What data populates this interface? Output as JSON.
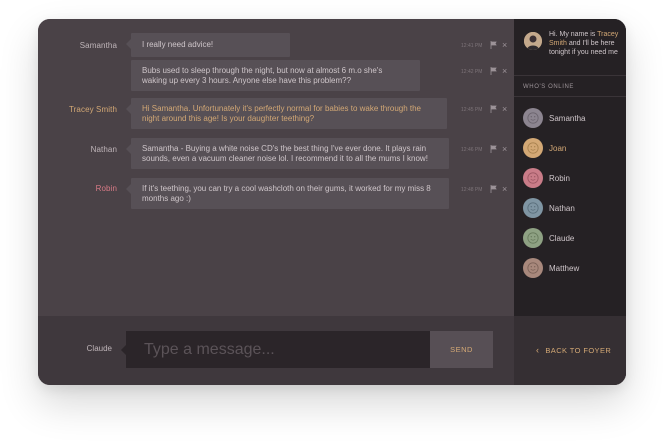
{
  "messages": [
    {
      "author": "Samantha",
      "text": "I really need advice!",
      "time": "12:41 PM"
    },
    {
      "author": "",
      "text": "Bubs used to sleep through the night, but now at almost 6 m.o she's waking up every 3 hours. Anyone else have this problem??",
      "time": "12:42 PM"
    },
    {
      "author": "Tracey Smith",
      "text": "Hi Samantha. Unfortunately it's perfectly normal for babies to wake through the night around this age! Is your daughter teething?",
      "time": "12:45 PM"
    },
    {
      "author": "Nathan",
      "text": "Samantha - Buying a white noise CD's the best thing I've ever done. It plays rain sounds, even a vacuum cleaner noise lol. I recommend it to all the mums I know!",
      "time": "12:46 PM"
    },
    {
      "author": "Robin",
      "text": "If it's teething, you can try a cool washcloth on their gums, it worked for my miss 8 months ago :)",
      "time": "12:48 PM"
    }
  ],
  "composer": {
    "user": "Claude",
    "placeholder": "Type a message...",
    "send_label": "SEND"
  },
  "sidebar": {
    "welcome_prefix": "Hi. My name is ",
    "welcome_name_1": "Tracey",
    "welcome_name_2": "Smith",
    "welcome_suffix_1": " and I'll be here",
    "welcome_line3": "tonight if you need me",
    "online_heading": "WHO'S ONLINE",
    "users": [
      {
        "name": "Samantha",
        "color": "#8c8590"
      },
      {
        "name": "Joan",
        "color": "#d3a875"
      },
      {
        "name": "Robin",
        "color": "#c97c88"
      },
      {
        "name": "Nathan",
        "color": "#7f95a3"
      },
      {
        "name": "Claude",
        "color": "#8ea183"
      },
      {
        "name": "Matthew",
        "color": "#a8887c"
      }
    ],
    "back_label": "BACK TO FOYER"
  },
  "icons": {
    "flag": "flag-icon",
    "close": "close-icon",
    "back": "chevron-left-icon",
    "avatar": "smiley-avatar-icon"
  },
  "colors": {
    "accent": "#d3a875",
    "robin": "#d77a86",
    "panel": "#4a4247",
    "sidebar": "#252124"
  }
}
